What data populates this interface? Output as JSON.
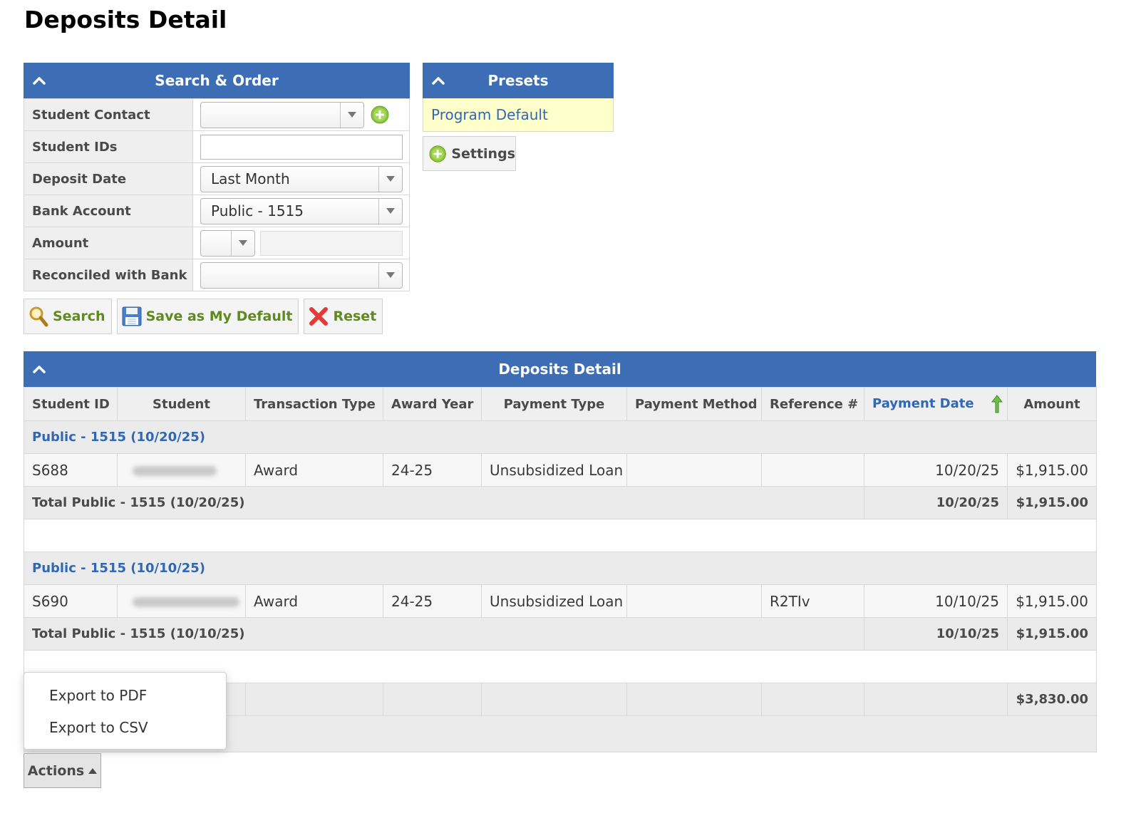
{
  "page": {
    "title": "Deposits Detail"
  },
  "search_panel": {
    "title": "Search & Order",
    "fields": {
      "student_contact": {
        "label": "Student Contact",
        "value": ""
      },
      "student_ids": {
        "label": "Student IDs",
        "value": ""
      },
      "deposit_date": {
        "label": "Deposit Date",
        "value": "Last Month"
      },
      "bank_account": {
        "label": "Bank Account",
        "value": "Public - 1515"
      },
      "amount": {
        "label": "Amount",
        "operator": "",
        "value": ""
      },
      "reconciled": {
        "label": "Reconciled with Bank",
        "value": ""
      }
    },
    "buttons": {
      "search": "Search",
      "save_default": "Save as My Default",
      "reset": "Reset"
    }
  },
  "presets_panel": {
    "title": "Presets",
    "items": [
      "Program Default"
    ],
    "settings_label": "Settings"
  },
  "results": {
    "title": "Deposits Detail",
    "columns": [
      "Student ID",
      "Student",
      "Transaction Type",
      "Award Year",
      "Payment Type",
      "Payment Method",
      "Reference #",
      "Payment Date",
      "Amount"
    ],
    "sorted_column": "Payment Date",
    "groups": [
      {
        "header": "Public - 1515 (10/20/25)",
        "rows": [
          {
            "student_id": "S688",
            "student": "",
            "transaction_type": "Award",
            "award_year": "24-25",
            "payment_type": "Unsubsidized Loan",
            "payment_method": "",
            "reference": "",
            "payment_date": "10/20/25",
            "amount": "$1,915.00"
          }
        ],
        "total_label": "Total Public - 1515 (10/20/25)",
        "total_date": "10/20/25",
        "total_amount": "$1,915.00"
      },
      {
        "header": "Public - 1515 (10/10/25)",
        "rows": [
          {
            "student_id": "S690",
            "student": "",
            "transaction_type": "Award",
            "award_year": "24-25",
            "payment_type": "Unsubsidized Loan",
            "payment_method": "",
            "reference": "R2TIv",
            "payment_date": "10/10/25",
            "amount": "$1,915.00"
          }
        ],
        "total_label": "Total Public - 1515 (10/10/25)",
        "total_date": "10/10/25",
        "total_amount": "$1,915.00"
      }
    ],
    "grand_total": "$3,830.00"
  },
  "actions_menu": {
    "button_label": "Actions",
    "items": [
      "Export to PDF",
      "Export to CSV"
    ]
  },
  "colors": {
    "header_blue": "#3d6db5",
    "link_blue": "#2f68b5",
    "button_green": "#5e8a1e",
    "preset_yellow": "#ffffcc"
  }
}
